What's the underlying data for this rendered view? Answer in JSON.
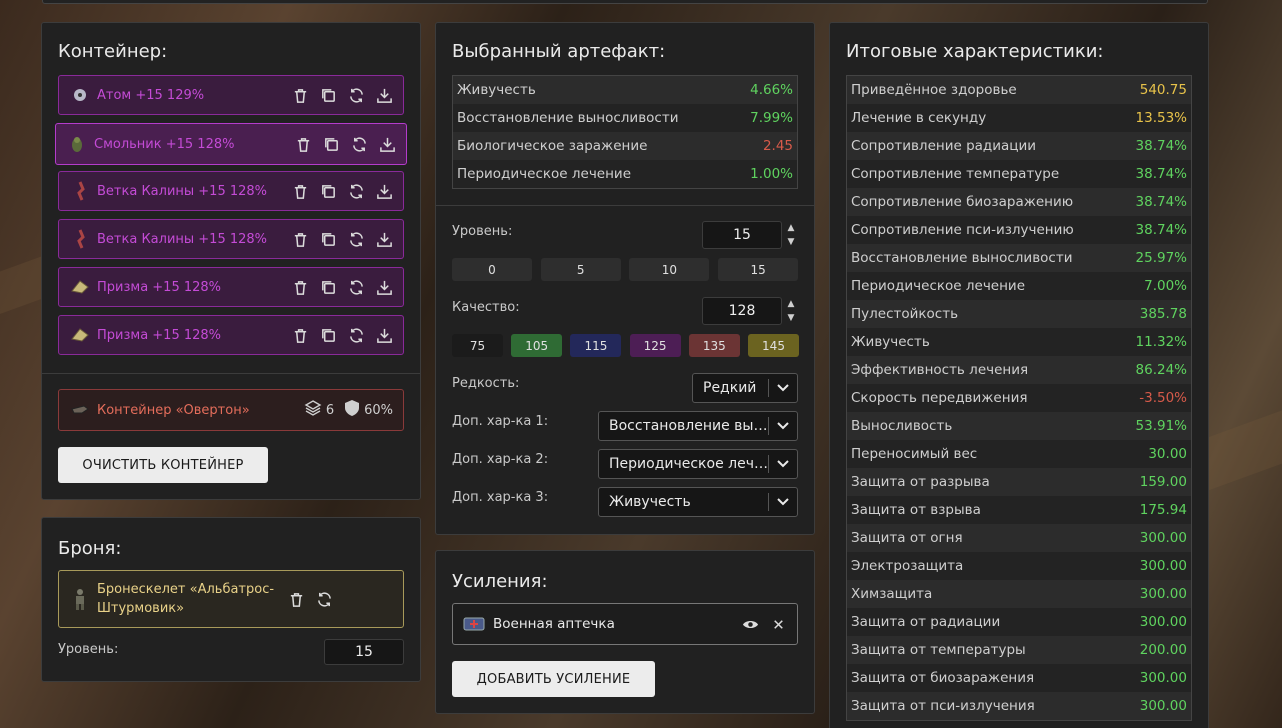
{
  "container_panel": {
    "title": "Контейнер:",
    "artifacts": [
      {
        "name": "Атом +15 129%",
        "icon": "atom-artifact-icon"
      },
      {
        "name": "Смольник +15 128%",
        "icon": "smolnik-artifact-icon"
      },
      {
        "name": "Ветка Калины +15 128%",
        "icon": "kalina-branch-artifact-icon"
      },
      {
        "name": "Ветка Калины +15 128%",
        "icon": "kalina-branch-artifact-icon"
      },
      {
        "name": "Призма +15 128%",
        "icon": "prism-artifact-icon"
      },
      {
        "name": "Призма +15 128%",
        "icon": "prism-artifact-icon"
      }
    ],
    "container": {
      "name": "Контейнер «Овертон»",
      "slots": "6",
      "protection": "60%"
    },
    "clear_button": "ОЧИСТИТЬ КОНТЕЙНЕР"
  },
  "armor_panel": {
    "title": "Броня:",
    "armor_name": "Бронескелет «Альбатрос-Штурмовик»",
    "level_label": "Уровень:",
    "level_value": "15"
  },
  "artifact_panel": {
    "title": "Выбранный артефакт:",
    "stats": [
      {
        "label": "Живучесть",
        "value": "4.66%",
        "color": "green"
      },
      {
        "label": "Восстановление выносливости",
        "value": "7.99%",
        "color": "green"
      },
      {
        "label": "Биологическое заражение",
        "value": "2.45",
        "color": "red"
      },
      {
        "label": "Периодическое лечение",
        "value": "1.00%",
        "color": "green"
      }
    ],
    "level_label": "Уровень:",
    "level_value": "15",
    "level_presets": [
      "0",
      "5",
      "10",
      "15"
    ],
    "quality_label": "Качество:",
    "quality_value": "128",
    "quality_presets": [
      {
        "label": "75",
        "color": "#1b1b1b"
      },
      {
        "label": "105",
        "color": "#2f6b34"
      },
      {
        "label": "115",
        "color": "#23285a"
      },
      {
        "label": "125",
        "color": "#4d1e55"
      },
      {
        "label": "135",
        "color": "#6b3434"
      },
      {
        "label": "145",
        "color": "#6b6320"
      }
    ],
    "rarity_label": "Редкость:",
    "rarity_value": "Редкий",
    "extra1_label": "Доп. хар-ка 1:",
    "extra1_value": "Восстановление выносливости",
    "extra2_label": "Доп. хар-ка 2:",
    "extra2_value": "Периодическое лечение",
    "extra3_label": "Доп. хар-ка 3:",
    "extra3_value": "Живучесть"
  },
  "boost_panel": {
    "title": "Усиления:",
    "boost_name": "Военная аптечка",
    "add_button": "ДОБАВИТЬ УСИЛЕНИЕ"
  },
  "totals_panel": {
    "title": "Итоговые характеристики:",
    "stats": [
      {
        "label": "Приведённое здоровье",
        "value": "540.75",
        "color": "yellow"
      },
      {
        "label": "Лечение в секунду",
        "value": "13.53%",
        "color": "yellow"
      },
      {
        "label": "Сопротивление радиации",
        "value": "38.74%",
        "color": "green"
      },
      {
        "label": "Сопротивление температуре",
        "value": "38.74%",
        "color": "green"
      },
      {
        "label": "Сопротивление биозаражению",
        "value": "38.74%",
        "color": "green"
      },
      {
        "label": "Сопротивление пси-излучению",
        "value": "38.74%",
        "color": "green"
      },
      {
        "label": "Восстановление выносливости",
        "value": "25.97%",
        "color": "green"
      },
      {
        "label": "Периодическое лечение",
        "value": "7.00%",
        "color": "green"
      },
      {
        "label": "Пулестойкость",
        "value": "385.78",
        "color": "green"
      },
      {
        "label": "Живучесть",
        "value": "11.32%",
        "color": "green"
      },
      {
        "label": "Эффективность лечения",
        "value": "86.24%",
        "color": "green"
      },
      {
        "label": "Скорость передвижения",
        "value": "-3.50%",
        "color": "red"
      },
      {
        "label": "Выносливость",
        "value": "53.91%",
        "color": "green"
      },
      {
        "label": "Переносимый вес",
        "value": "30.00",
        "color": "green"
      },
      {
        "label": "Защита от разрыва",
        "value": "159.00",
        "color": "green"
      },
      {
        "label": "Защита от взрыва",
        "value": "175.94",
        "color": "green"
      },
      {
        "label": "Защита от огня",
        "value": "300.00",
        "color": "green"
      },
      {
        "label": "Электрозащита",
        "value": "300.00",
        "color": "green"
      },
      {
        "label": "Химзащита",
        "value": "300.00",
        "color": "green"
      },
      {
        "label": "Защита от радиации",
        "value": "300.00",
        "color": "green"
      },
      {
        "label": "Защита от температуры",
        "value": "200.00",
        "color": "green"
      },
      {
        "label": "Защита от биозаражения",
        "value": "300.00",
        "color": "green"
      },
      {
        "label": "Защита от пси-излучения",
        "value": "300.00",
        "color": "green"
      }
    ]
  }
}
